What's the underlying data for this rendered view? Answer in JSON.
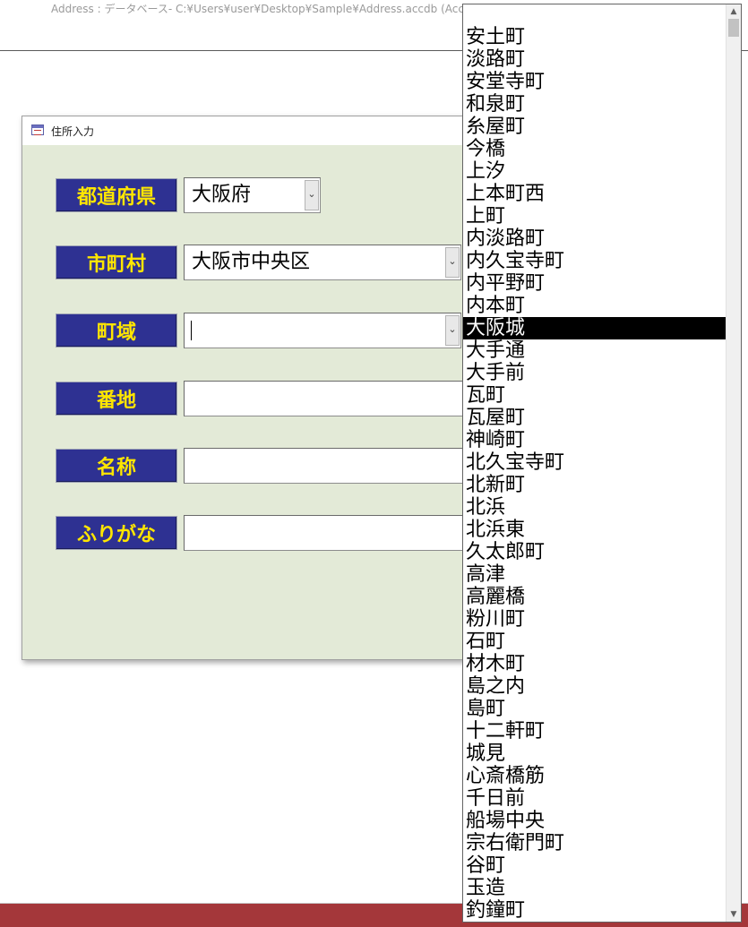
{
  "window": {
    "title": "Address : データベース- C:¥Users¥user¥Desktop¥Sample¥Address.accdb (Access"
  },
  "form": {
    "title": "住所入力",
    "fields": [
      {
        "label": "都道府県",
        "value": "大阪府"
      },
      {
        "label": "市町村",
        "value": "大阪市中央区"
      },
      {
        "label": "町域",
        "value": ""
      },
      {
        "label": "番地",
        "value": ""
      },
      {
        "label": "名称",
        "value": ""
      },
      {
        "label": "ふりがな",
        "value": ""
      }
    ]
  },
  "dropdown": {
    "selected": "大阪城",
    "items": [
      "安土町",
      "淡路町",
      "安堂寺町",
      "和泉町",
      "糸屋町",
      "今橋",
      "上汐",
      "上本町西",
      "上町",
      "内淡路町",
      "内久宝寺町",
      "内平野町",
      "内本町",
      "大阪城",
      "大手通",
      "大手前",
      "瓦町",
      "瓦屋町",
      "神崎町",
      "北久宝寺町",
      "北新町",
      "北浜",
      "北浜東",
      "久太郎町",
      "高津",
      "高麗橋",
      "粉川町",
      "石町",
      "材木町",
      "島之内",
      "島町",
      "十二軒町",
      "城見",
      "心斎橋筋",
      "千日前",
      "船場中央",
      "宗右衛門町",
      "谷町",
      "玉造",
      "釣鐘町"
    ]
  },
  "colors": {
    "label_bg": "#2e3192",
    "label_text": "#ffe600",
    "form_bg": "#e3ead7",
    "status_bar": "#a4373a",
    "selection_bg": "#000000"
  }
}
